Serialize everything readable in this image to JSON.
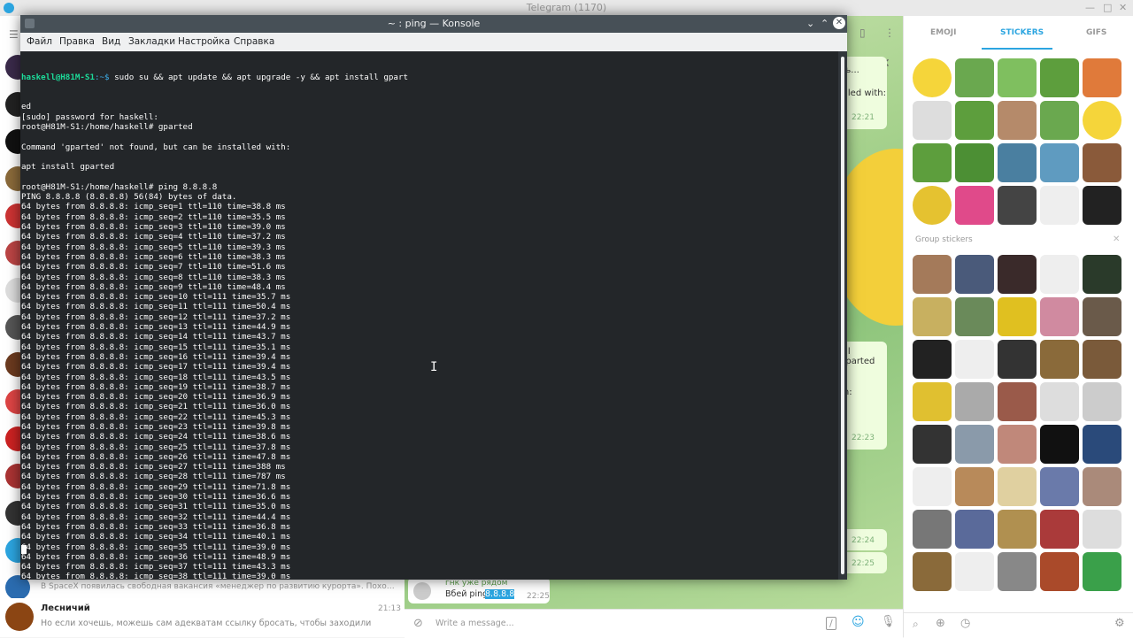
{
  "telegram": {
    "window_title": "Telegram (1170)",
    "chat_preview_snippet": "В SpaceX появилась свободная вакансия «менеджер по развитию курорта». Похоже, на ст...",
    "last_chat": {
      "name": "Лесничий",
      "time": "21:13",
      "preview": "Но если хочешь, можешь сам адекватам ссылку бросать, чтобы заходили"
    },
    "chat_fragments": {
      "frag1": "ль...",
      "frag2": "alled with:",
      "time1": "22:21",
      "frag3": "all gparted",
      "frag4": "th:",
      "time2": "22:23",
      "time3": "22:24",
      "time4": "22:25"
    },
    "last_message": {
      "author": "гнк уже рядом",
      "text": "Вбей ping",
      "highlight": "8.8.8.8",
      "time": "22:25"
    },
    "compose_placeholder": "Write a message...",
    "sticker_tabs": [
      "EMOJI",
      "STICKERS",
      "GIFS"
    ],
    "group_stickers_label": "Group stickers",
    "accent_color": "#2ca5e0"
  },
  "konsole": {
    "title": "~ : ping — Konsole",
    "menu": [
      "Файл",
      "Правка",
      "Вид",
      "Закладки",
      "Настройка",
      "Справка"
    ],
    "prompt_user": "haskell@H81M-S1",
    "prompt_suffix": ":~$",
    "first_command": " sudo su && apt update && apt upgrade -y && apt install gpart",
    "output_lines": [
      "ed",
      "[sudo] password for haskell:",
      "root@H81M-S1:/home/haskell# gparted",
      "",
      "Command 'gparted' not found, but can be installed with:",
      "",
      "apt install gparted",
      "",
      "root@H81M-S1:/home/haskell# ping 8.8.8.8",
      "PING 8.8.8.8 (8.8.8.8) 56(84) bytes of data.",
      "64 bytes from 8.8.8.8: icmp_seq=1 ttl=110 time=38.8 ms",
      "64 bytes from 8.8.8.8: icmp_seq=2 ttl=110 time=35.5 ms",
      "64 bytes from 8.8.8.8: icmp_seq=3 ttl=110 time=39.0 ms",
      "64 bytes from 8.8.8.8: icmp_seq=4 ttl=110 time=37.2 ms",
      "64 bytes from 8.8.8.8: icmp_seq=5 ttl=110 time=39.3 ms",
      "64 bytes from 8.8.8.8: icmp_seq=6 ttl=110 time=38.3 ms",
      "64 bytes from 8.8.8.8: icmp_seq=7 ttl=110 time=51.6 ms",
      "64 bytes from 8.8.8.8: icmp_seq=8 ttl=110 time=38.3 ms",
      "64 bytes from 8.8.8.8: icmp_seq=9 ttl=110 time=48.4 ms",
      "64 bytes from 8.8.8.8: icmp_seq=10 ttl=111 time=35.7 ms",
      "64 bytes from 8.8.8.8: icmp_seq=11 ttl=111 time=50.4 ms",
      "64 bytes from 8.8.8.8: icmp_seq=12 ttl=111 time=37.2 ms",
      "64 bytes from 8.8.8.8: icmp_seq=13 ttl=111 time=44.9 ms",
      "64 bytes from 8.8.8.8: icmp_seq=14 ttl=111 time=43.7 ms",
      "64 bytes from 8.8.8.8: icmp_seq=15 ttl=111 time=35.1 ms",
      "64 bytes from 8.8.8.8: icmp_seq=16 ttl=111 time=39.4 ms",
      "64 bytes from 8.8.8.8: icmp_seq=17 ttl=111 time=39.4 ms",
      "64 bytes from 8.8.8.8: icmp_seq=18 ttl=111 time=43.5 ms",
      "64 bytes from 8.8.8.8: icmp_seq=19 ttl=111 time=38.7 ms",
      "64 bytes from 8.8.8.8: icmp_seq=20 ttl=111 time=36.9 ms",
      "64 bytes from 8.8.8.8: icmp_seq=21 ttl=111 time=36.0 ms",
      "64 bytes from 8.8.8.8: icmp_seq=22 ttl=111 time=45.3 ms",
      "64 bytes from 8.8.8.8: icmp_seq=23 ttl=111 time=39.8 ms",
      "64 bytes from 8.8.8.8: icmp_seq=24 ttl=111 time=38.6 ms",
      "64 bytes from 8.8.8.8: icmp_seq=25 ttl=111 time=37.8 ms",
      "64 bytes from 8.8.8.8: icmp_seq=26 ttl=111 time=47.8 ms",
      "64 bytes from 8.8.8.8: icmp_seq=27 ttl=111 time=388 ms",
      "64 bytes from 8.8.8.8: icmp_seq=28 ttl=111 time=787 ms",
      "64 bytes from 8.8.8.8: icmp_seq=29 ttl=111 time=71.8 ms",
      "64 bytes from 8.8.8.8: icmp_seq=30 ttl=111 time=36.6 ms",
      "64 bytes from 8.8.8.8: icmp_seq=31 ttl=111 time=35.0 ms",
      "64 bytes from 8.8.8.8: icmp_seq=32 ttl=111 time=44.4 ms",
      "64 bytes from 8.8.8.8: icmp_seq=33 ttl=111 time=36.8 ms",
      "64 bytes from 8.8.8.8: icmp_seq=34 ttl=111 time=40.1 ms",
      "64 bytes from 8.8.8.8: icmp_seq=35 ttl=111 time=39.0 ms",
      "64 bytes from 8.8.8.8: icmp_seq=36 ttl=111 time=48.9 ms",
      "64 bytes from 8.8.8.8: icmp_seq=37 ttl=111 time=43.3 ms",
      "64 bytes from 8.8.8.8: icmp_seq=38 ttl=111 time=39.0 ms"
    ],
    "colors": {
      "terminal_bg": "#232629",
      "terminal_fg": "#fcfcfc",
      "prompt_user": "#1cdc9a",
      "prompt_path": "#3daee9",
      "titlebar": "#475057"
    }
  }
}
